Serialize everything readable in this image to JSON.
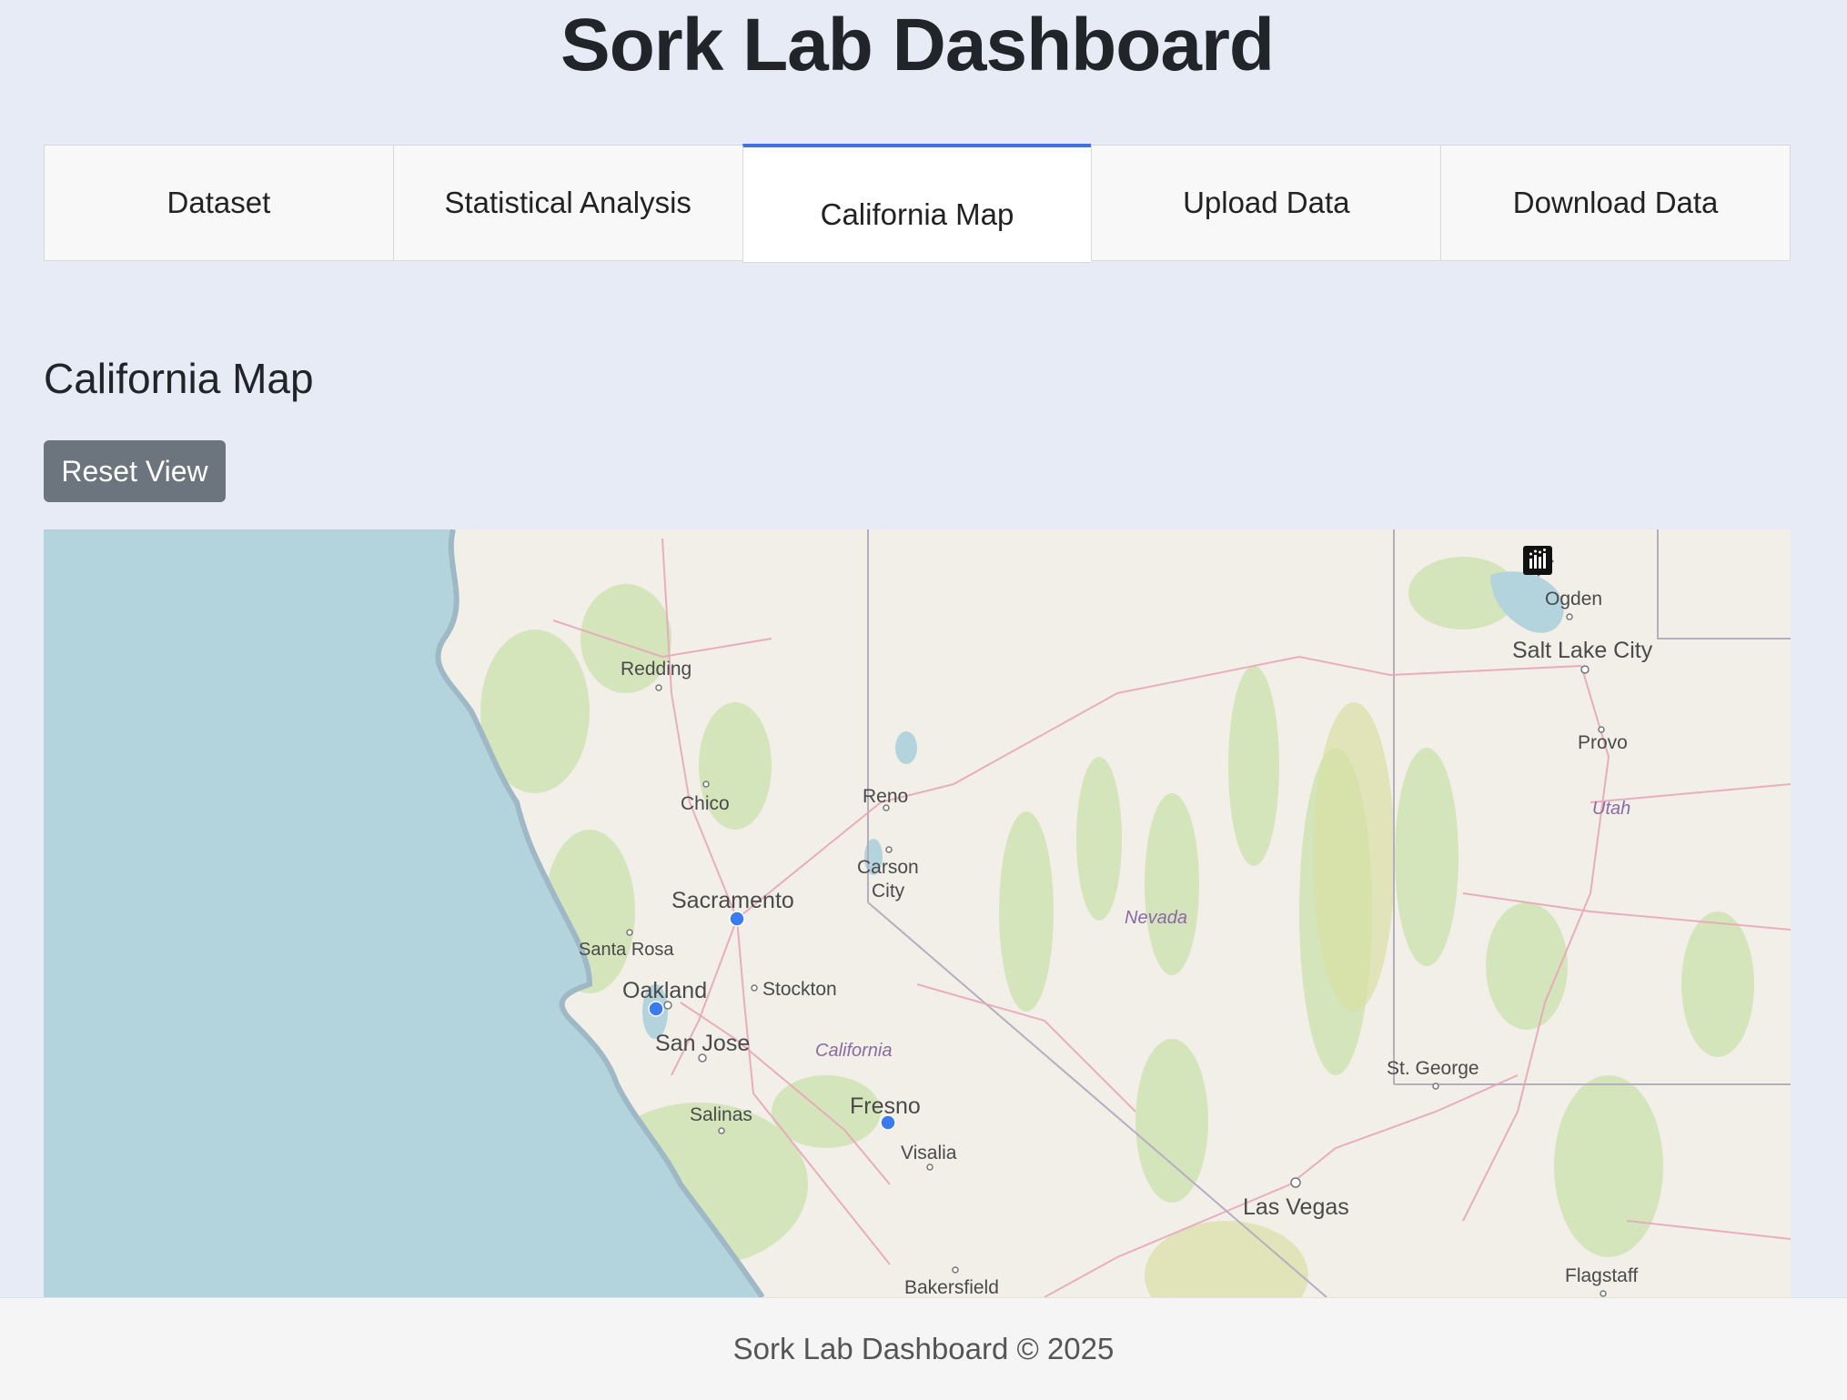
{
  "page": {
    "title": "Sork Lab Dashboard"
  },
  "tabs": [
    {
      "label": "Dataset",
      "active": false
    },
    {
      "label": "Statistical Analysis",
      "active": false
    },
    {
      "label": "California Map",
      "active": true
    },
    {
      "label": "Upload Data",
      "active": false
    },
    {
      "label": "Download Data",
      "active": false
    }
  ],
  "content": {
    "section_title": "California Map",
    "reset_button": "Reset View"
  },
  "map": {
    "accent_color": "#3f74e0",
    "marker_color": "#3b7bf0",
    "modebar_icons": [
      "camera-icon",
      "pan-icon",
      "zoom-in-icon",
      "zoom-out-icon",
      "home-icon",
      "plotly-logo-icon"
    ],
    "cities": {
      "ogden": "Ogden",
      "salt_lake_city": "Salt Lake City",
      "provo": "Provo",
      "utah": "Utah",
      "redding": "Redding",
      "chico": "Chico",
      "reno": "Reno",
      "carson_city_1": "Carson",
      "carson_city_2": "City",
      "sacramento": "Sacramento",
      "nevada": "Nevada",
      "santa_rosa": "Santa Rosa",
      "oakland": "Oakland",
      "stockton": "Stockton",
      "san_jose": "San Jose",
      "california": "California",
      "st_george": "St. George",
      "fresno": "Fresno",
      "salinas": "Salinas",
      "visalia": "Visalia",
      "las_vegas": "Las Vegas",
      "bakersfield": "Bakersfield",
      "flagstaff": "Flagstaff"
    },
    "markers": [
      "Sacramento",
      "Oakland",
      "Fresno"
    ]
  },
  "footer": {
    "text": "Sork Lab Dashboard © 2025"
  }
}
